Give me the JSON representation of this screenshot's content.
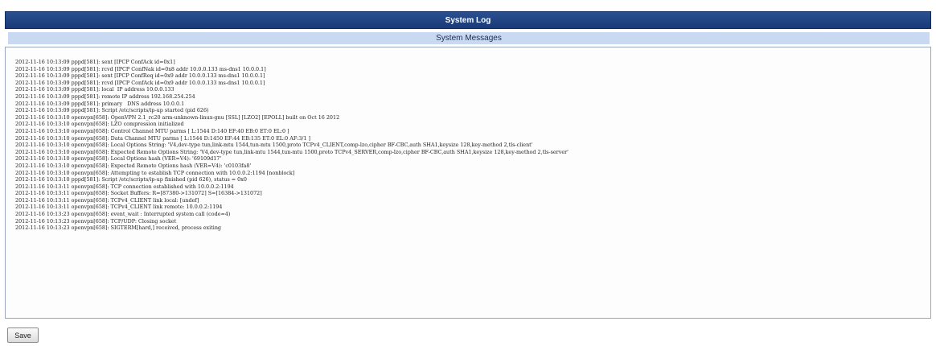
{
  "header": {
    "title": "System Log",
    "subtitle": "System Messages"
  },
  "log": {
    "lines": [
      "2012-11-16 10:13:09 pppd[581]: sent [IPCP ConfAck id=0x1]",
      "2012-11-16 10:13:09 pppd[581]: rcvd [IPCP ConfNak id=0x8 addr 10.0.0.133 ms-dns1 10.0.0.1]",
      "2012-11-16 10:13:09 pppd[581]: sent [IPCP ConfReq id=0x9 addr 10.0.0.133 ms-dns1 10.0.0.1]",
      "2012-11-16 10:13:09 pppd[581]: rcvd [IPCP ConfAck id=0x9 addr 10.0.0.133 ms-dns1 10.0.0.1]",
      "2012-11-16 10:13:09 pppd[581]: local  IP address 10.0.0.133",
      "2012-11-16 10:13:09 pppd[581]: remote IP address 192.168.254.254",
      "2012-11-16 10:13:09 pppd[581]: primary   DNS address 10.0.0.1",
      "2012-11-16 10:13:09 pppd[581]: Script /etc/scripts/ip-up started (pid 626)",
      "2012-11-16 10:13:10 openvpn[658]: OpenVPN 2.1_rc20 arm-unknown-linux-gnu [SSL] [LZO2] [EPOLL] built on Oct 16 2012",
      "2012-11-16 10:13:10 openvpn[658]: LZO compression initialized",
      "2012-11-16 10:13:10 openvpn[658]: Control Channel MTU parms [ L:1544 D:140 EF:40 EB:0 ET:0 EL:0 ]",
      "2012-11-16 10:13:10 openvpn[658]: Data Channel MTU parms [ L:1544 D:1450 EF:44 EB:135 ET:0 EL:0 AF:3/1 ]",
      "2012-11-16 10:13:10 openvpn[658]: Local Options String: 'V4,dev-type tun,link-mtu 1544,tun-mtu 1500,proto TCPv4_CLIENT,comp-lzo,cipher BF-CBC,auth SHA1,keysize 128,key-method 2,tls-client'",
      "2012-11-16 10:13:10 openvpn[658]: Expected Remote Options String: 'V4,dev-type tun,link-mtu 1544,tun-mtu 1500,proto TCPv4_SERVER,comp-lzo,cipher BF-CBC,auth SHA1,keysize 128,key-method 2,tls-server'",
      "2012-11-16 10:13:10 openvpn[658]: Local Options hash (VER=V4): '69109d17'",
      "2012-11-16 10:13:10 openvpn[658]: Expected Remote Options hash (VER=V4): 'c0103fa8'",
      "2012-11-16 10:13:10 openvpn[658]: Attempting to establish TCP connection with 10.0.0.2:1194 [nonblock]",
      "2012-11-16 10:13:10 pppd[581]: Script /etc/scripts/ip-up finished (pid 626), status = 0x0",
      "2012-11-16 10:13:11 openvpn[658]: TCP connection established with 10.0.0.2:1194",
      "2012-11-16 10:13:11 openvpn[658]: Socket Buffers: R=[87380->131072] S=[16384->131072]",
      "2012-11-16 10:13:11 openvpn[658]: TCPv4_CLIENT link local: [undef]",
      "2012-11-16 10:13:11 openvpn[658]: TCPv4_CLIENT link remote: 10.0.0.2:1194",
      "2012-11-16 10:13:23 openvpn[658]: event_wait : Interrupted system call (code=4)",
      "2012-11-16 10:13:23 openvpn[658]: TCP/UDP: Closing socket",
      "2012-11-16 10:13:23 openvpn[658]: SIGTERM[hard,] received, process exiting"
    ]
  },
  "actions": {
    "save_label": "Save"
  }
}
